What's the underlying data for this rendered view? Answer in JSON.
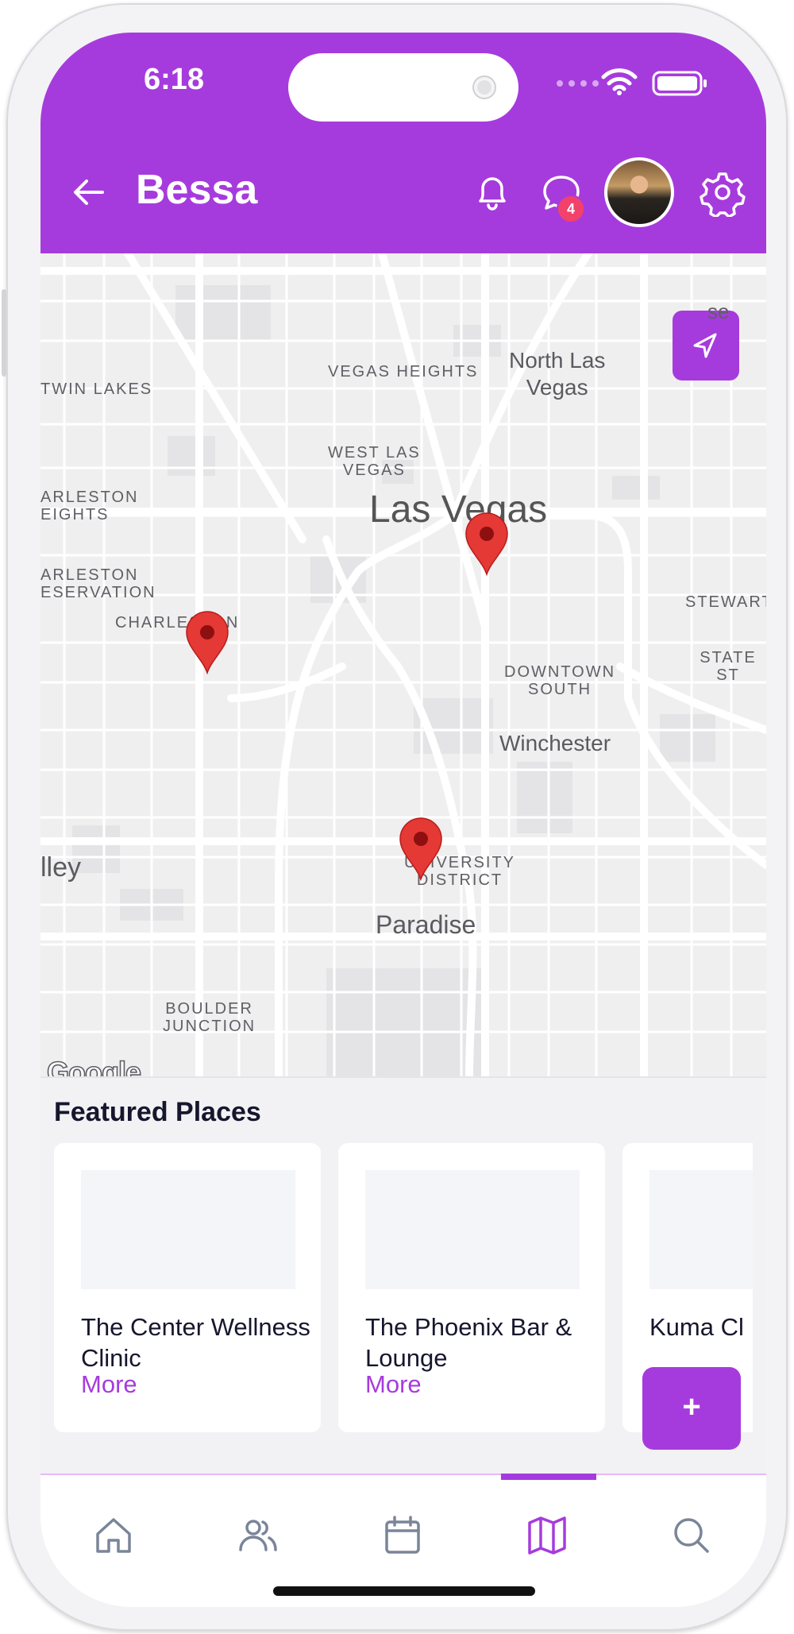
{
  "status_bar": {
    "time": "6:18"
  },
  "header": {
    "title": "Bessa",
    "notification_badge": "4",
    "accent_color": "#a63bdd"
  },
  "map": {
    "labels": {
      "vegas_heights": "VEGAS HEIGHTS",
      "north_las_vegas": "North Las\nVegas",
      "twin_lakes": "TWIN LAKES",
      "west_las_vegas": "WEST LAS\nVEGAS",
      "charleston_heights": "ARLESTON\nEIGHTS",
      "charleston_reservation": "ARLESTON\nESERVATION",
      "charleston": "CHARLESTON",
      "las_vegas": "Las Vegas",
      "stewart": "STEWART",
      "state_st": "STATE ST",
      "downtown_south": "DOWNTOWN\nSOUTH",
      "winchester": "Winchester",
      "valley": "lley",
      "university_district": "UNIVERSITY\nDISTRICT",
      "paradise": "Paradise",
      "boulder_junction": "BOULDER\nJUNCTION",
      "partial_top_right": "se"
    },
    "attribution": "Google",
    "pin_color": "#e53935"
  },
  "featured": {
    "title": "Featured Places",
    "places": [
      {
        "name": "The Center Wellness Clinic",
        "more": "More"
      },
      {
        "name": "The Phoenix Bar & Lounge",
        "more": "More"
      },
      {
        "name": "Kuma Cl",
        "more": ""
      }
    ],
    "fab_label": "+"
  },
  "tabs": [
    {
      "name": "home",
      "icon": "home-icon",
      "active": false
    },
    {
      "name": "people",
      "icon": "users-icon",
      "active": false
    },
    {
      "name": "calendar",
      "icon": "calendar-icon",
      "active": false
    },
    {
      "name": "map",
      "icon": "map-icon",
      "active": true
    },
    {
      "name": "search",
      "icon": "search-icon",
      "active": false
    }
  ]
}
